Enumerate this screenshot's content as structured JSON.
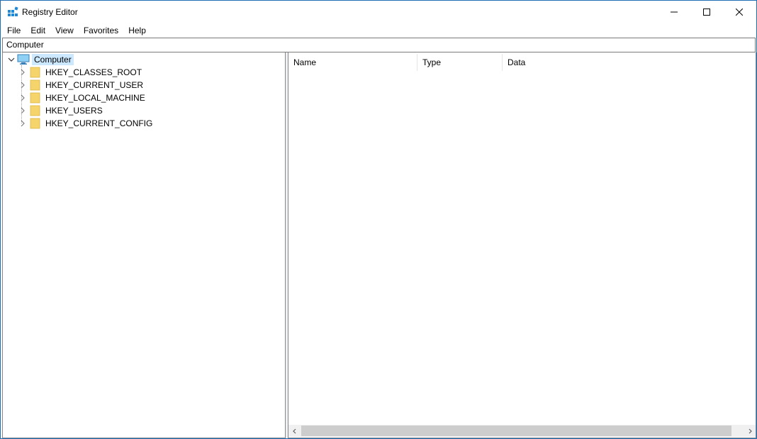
{
  "window": {
    "title": "Registry Editor"
  },
  "menu": [
    "File",
    "Edit",
    "View",
    "Favorites",
    "Help"
  ],
  "address": "Computer",
  "tree": {
    "root": "Computer",
    "items": [
      "HKEY_CLASSES_ROOT",
      "HKEY_CURRENT_USER",
      "HKEY_LOCAL_MACHINE",
      "HKEY_USERS",
      "HKEY_CURRENT_CONFIG"
    ]
  },
  "list": {
    "columns": [
      "Name",
      "Type",
      "Data"
    ]
  },
  "colors": {
    "accent": "#1f6fb5",
    "selection": "#cce8ff",
    "folder": "#f5d46b"
  },
  "icons": [
    "registry-app-icon",
    "minimize-icon",
    "maximize-icon",
    "close-icon",
    "computer-icon",
    "folder-icon",
    "chevron-right-icon",
    "chevron-down-icon",
    "scroll-left-icon",
    "scroll-right-icon"
  ]
}
